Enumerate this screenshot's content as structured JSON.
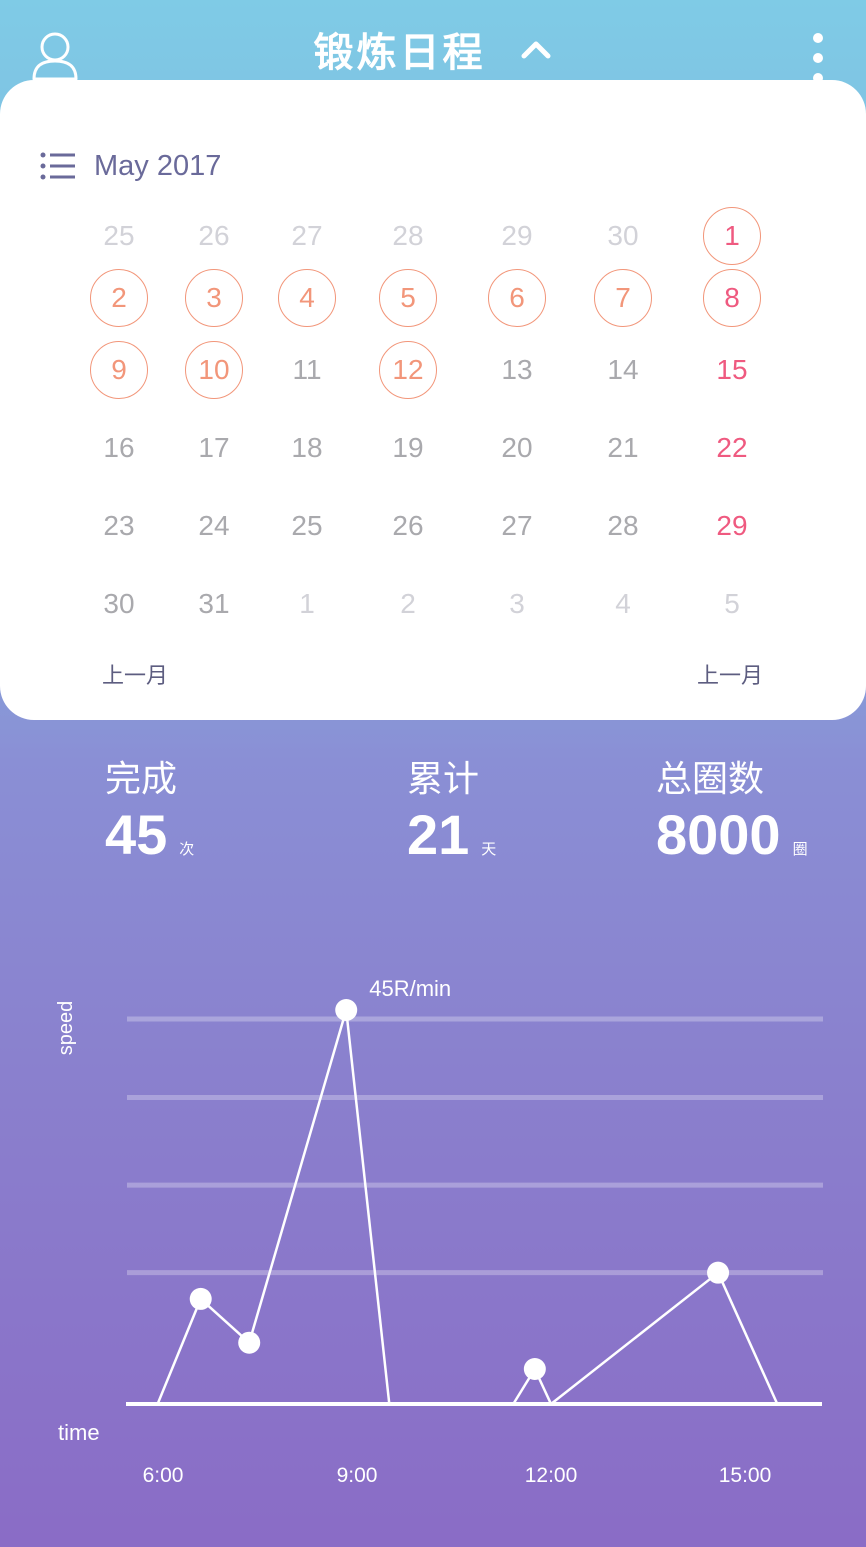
{
  "header": {
    "title": "锻炼日程",
    "left_icon": "user-icon",
    "collapse_icon": "chevron-up-icon",
    "right_icon": "more-vertical-icon"
  },
  "calendar": {
    "month_label": "May 2017",
    "list_icon": "list-icon",
    "weeks": [
      [
        {
          "d": "25",
          "s": "muted"
        },
        {
          "d": "26",
          "s": "muted"
        },
        {
          "d": "27",
          "s": "muted"
        },
        {
          "d": "28",
          "s": "muted"
        },
        {
          "d": "29",
          "s": "muted"
        },
        {
          "d": "30",
          "s": "muted"
        },
        {
          "d": "1",
          "s": "red-ring"
        }
      ],
      [
        {
          "d": "2",
          "s": "orange-ring"
        },
        {
          "d": "3",
          "s": "orange-ring"
        },
        {
          "d": "4",
          "s": "orange-ring"
        },
        {
          "d": "5",
          "s": "orange-ring"
        },
        {
          "d": "6",
          "s": "orange-ring"
        },
        {
          "d": "7",
          "s": "orange-ring"
        },
        {
          "d": "8",
          "s": "red-ring"
        }
      ],
      [
        {
          "d": "9",
          "s": "orange-ring"
        },
        {
          "d": "10",
          "s": "orange-ring"
        },
        {
          "d": "11",
          "s": "normal"
        },
        {
          "d": "12",
          "s": "orange-ring"
        },
        {
          "d": "13",
          "s": "normal"
        },
        {
          "d": "14",
          "s": "normal"
        },
        {
          "d": "15",
          "s": "red"
        }
      ],
      [
        {
          "d": "16",
          "s": "normal"
        },
        {
          "d": "17",
          "s": "normal"
        },
        {
          "d": "18",
          "s": "normal"
        },
        {
          "d": "19",
          "s": "normal"
        },
        {
          "d": "20",
          "s": "normal"
        },
        {
          "d": "21",
          "s": "normal"
        },
        {
          "d": "22",
          "s": "red"
        }
      ],
      [
        {
          "d": "23",
          "s": "normal"
        },
        {
          "d": "24",
          "s": "normal"
        },
        {
          "d": "25",
          "s": "normal"
        },
        {
          "d": "26",
          "s": "normal"
        },
        {
          "d": "27",
          "s": "normal"
        },
        {
          "d": "28",
          "s": "normal"
        },
        {
          "d": "29",
          "s": "red"
        }
      ],
      [
        {
          "d": "30",
          "s": "normal"
        },
        {
          "d": "31",
          "s": "normal"
        },
        {
          "d": "1",
          "s": "muted"
        },
        {
          "d": "2",
          "s": "muted"
        },
        {
          "d": "3",
          "s": "muted"
        },
        {
          "d": "4",
          "s": "muted"
        },
        {
          "d": "5",
          "s": "muted"
        }
      ]
    ],
    "prev_label": "上一月",
    "next_label": "上一月"
  },
  "stats": [
    {
      "label": "完成",
      "value": "45",
      "unit": "次"
    },
    {
      "label": "累计",
      "value": "21",
      "unit": "天"
    },
    {
      "label": "总圈数",
      "value": "8000",
      "unit": "圈"
    }
  ],
  "colors": {
    "accent_orange": "#f2967a",
    "weekend_red": "#ef5a80",
    "muted_day": "#d2d2d8",
    "normal_day": "#a9a9ad"
  },
  "chart_data": {
    "type": "line",
    "ylabel": "speed",
    "xlabel": "time",
    "x_ticks": [
      "6:00",
      "9:00",
      "12:00",
      "15:00"
    ],
    "ylim": [
      0,
      45
    ],
    "grid": true,
    "series": [
      {
        "points": [
          {
            "x": "5:55",
            "y": 0,
            "marker": false
          },
          {
            "x": "6:35",
            "y": 12,
            "marker": true
          },
          {
            "x": "7:20",
            "y": 7,
            "marker": true
          },
          {
            "x": "8:50",
            "y": 45,
            "marker": true
          },
          {
            "x": "9:30",
            "y": 0,
            "marker": false
          },
          {
            "x": "11:25",
            "y": 0,
            "marker": false
          },
          {
            "x": "11:45",
            "y": 4,
            "marker": true
          },
          {
            "x": "12:00",
            "y": 0,
            "marker": false
          },
          {
            "x": "14:35",
            "y": 15,
            "marker": true
          },
          {
            "x": "15:30",
            "y": 0,
            "marker": false
          }
        ]
      }
    ],
    "annotations": [
      {
        "x": "8:50",
        "y": 45,
        "text": "45R/min"
      }
    ]
  }
}
